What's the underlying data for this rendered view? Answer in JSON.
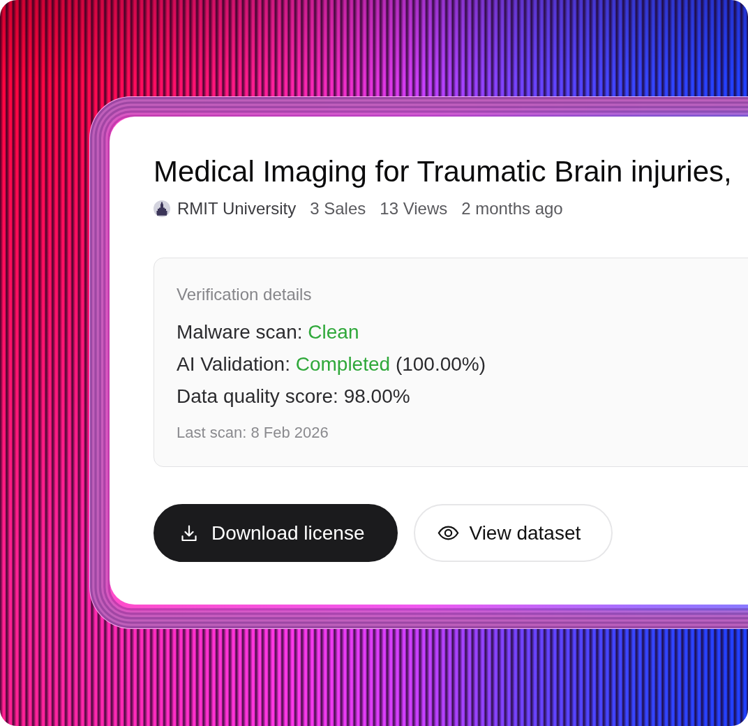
{
  "listing": {
    "title": "Medical Imaging for Traumatic Brain injuries,",
    "publisher": "RMIT University",
    "stats": [
      "3 Sales",
      "13 Views",
      "2 months ago"
    ]
  },
  "verification": {
    "heading": "Verification details",
    "rows": [
      {
        "kind": "status",
        "label": "Malware scan:",
        "value": "Clean"
      },
      {
        "kind": "status",
        "label": "AI Validation:",
        "value": "Completed",
        "detail": "(100.00%)"
      },
      {
        "kind": "plain",
        "label": "Data quality score:",
        "value": "98.00%"
      }
    ],
    "last_scan": "Last scan: 8 Feb 2026"
  },
  "actions": [
    {
      "kind": "primary",
      "label": "Download license"
    },
    {
      "kind": "secondary",
      "label": "View dataset"
    }
  ]
}
